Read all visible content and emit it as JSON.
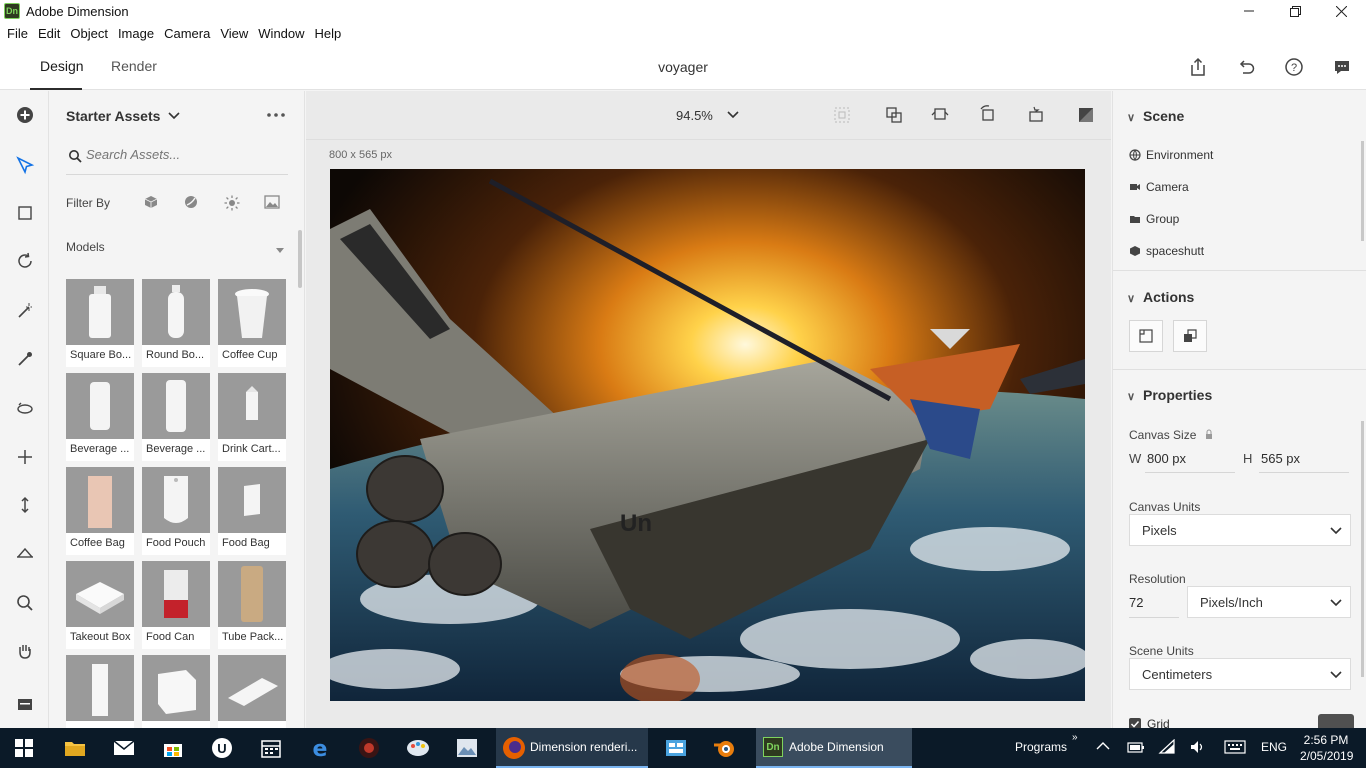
{
  "window": {
    "title": "Adobe Dimension",
    "app_badge": "Dn"
  },
  "menu": [
    "File",
    "Edit",
    "Object",
    "Image",
    "Camera",
    "View",
    "Window",
    "Help"
  ],
  "header": {
    "tab_design": "Design",
    "tab_render": "Render",
    "document_title": "voyager"
  },
  "assets": {
    "title": "Starter Assets",
    "search_placeholder": "Search Assets...",
    "filter_label": "Filter By",
    "section_label": "Models",
    "items": [
      {
        "label": "Square Bo..."
      },
      {
        "label": "Round Bo..."
      },
      {
        "label": "Coffee Cup"
      },
      {
        "label": "Beverage ..."
      },
      {
        "label": "Beverage ..."
      },
      {
        "label": "Drink Cart..."
      },
      {
        "label": "Coffee Bag"
      },
      {
        "label": "Food Pouch"
      },
      {
        "label": "Food Bag"
      },
      {
        "label": "Takeout Box"
      },
      {
        "label": "Food Can"
      },
      {
        "label": "Tube Pack..."
      },
      {
        "label": ""
      },
      {
        "label": ""
      },
      {
        "label": ""
      }
    ]
  },
  "canvas": {
    "zoom": "94.5%",
    "size_label": "800 x 565 px"
  },
  "scene": {
    "title": "Scene",
    "items": [
      "Environment",
      "Camera",
      "Group",
      "spaceshutt"
    ]
  },
  "actions": {
    "title": "Actions"
  },
  "properties": {
    "title": "Properties",
    "canvas_size_label": "Canvas Size",
    "w_label": "W",
    "w_value": "800 px",
    "h_label": "H",
    "h_value": "565 px",
    "canvas_units_label": "Canvas Units",
    "canvas_units_value": "Pixels",
    "resolution_label": "Resolution",
    "resolution_value": "72",
    "resolution_unit": "Pixels/Inch",
    "scene_units_label": "Scene Units",
    "scene_units_value": "Centimeters",
    "grid_label": "Grid"
  },
  "taskbar": {
    "firefox_title": "Dimension renderi...",
    "dimension_title": "Adobe Dimension",
    "programs_label": "Programs",
    "language": "ENG",
    "time": "2:56 PM",
    "date": "2/05/2019"
  },
  "colors": {
    "taskbar": "#0b1a28",
    "accent": "#2c2c2c",
    "dn_green": "#7fd35d"
  }
}
